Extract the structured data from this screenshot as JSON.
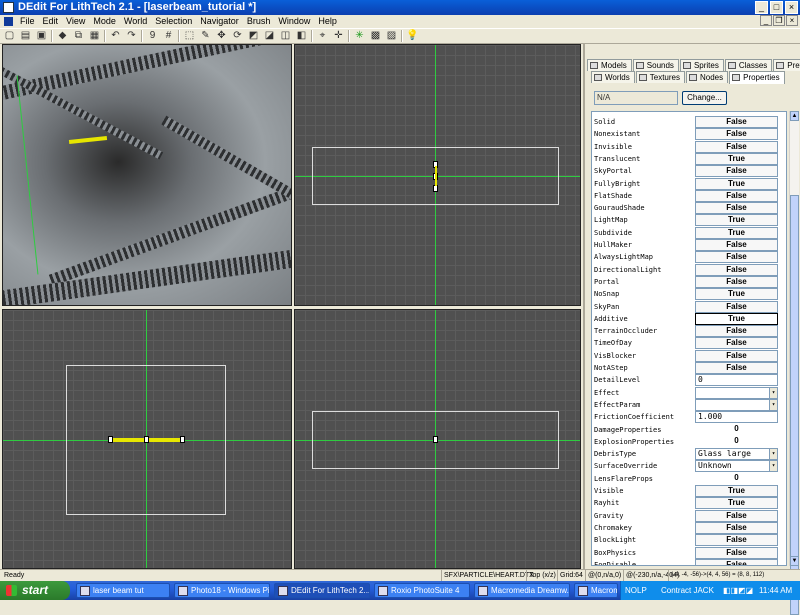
{
  "window": {
    "title": "DEdit For LithTech 2.1 - [laserbeam_tutorial *]",
    "min": "_",
    "max": "□",
    "close": "×"
  },
  "menu": [
    "File",
    "Edit",
    "View",
    "Mode",
    "World",
    "Selection",
    "Navigator",
    "Brush",
    "Window",
    "Help"
  ],
  "toolbar": {
    "icons": [
      "new-icon",
      "open-icon",
      "save-icon",
      "separator",
      "cut-icon",
      "copy-icon",
      "paste-icon",
      "separator",
      "undo-icon",
      "redo-icon",
      "separator",
      "grid-9-icon",
      "grid-icon",
      "separator",
      "select-icon",
      "brush-tool-icon",
      "move-icon",
      "rotate-icon",
      "geometry-icon",
      "paint-icon",
      "lightmap-icon",
      "object-icon",
      "separator",
      "crosshair-icon",
      "plus-icon",
      "separator",
      "green-star-icon",
      "render-icon",
      "fill-icon",
      "separator",
      "light-bulb-icon"
    ]
  },
  "panel": {
    "tabs_row1": [
      "Models",
      "Sounds",
      "Sprites",
      "Classes",
      "Prefabs"
    ],
    "tabs_row2": [
      "Worlds",
      "Textures",
      "Nodes",
      "Properties"
    ],
    "active_tab": "Properties",
    "field_value": "N/A",
    "change_button": "Change...",
    "properties": [
      {
        "name": "Solid",
        "value": "False"
      },
      {
        "name": "Nonexistant",
        "value": "False"
      },
      {
        "name": "Invisible",
        "value": "False"
      },
      {
        "name": "Translucent",
        "value": "True"
      },
      {
        "name": "SkyPortal",
        "value": "False"
      },
      {
        "name": "FullyBright",
        "value": "True"
      },
      {
        "name": "FlatShade",
        "value": "False"
      },
      {
        "name": "GouraudShade",
        "value": "False"
      },
      {
        "name": "LightMap",
        "value": "True"
      },
      {
        "name": "Subdivide",
        "value": "True"
      },
      {
        "name": "HullMaker",
        "value": "False"
      },
      {
        "name": "AlwaysLightMap",
        "value": "False"
      },
      {
        "name": "DirectionalLight",
        "value": "False"
      },
      {
        "name": "Portal",
        "value": "False"
      },
      {
        "name": "NoSnap",
        "value": "True"
      },
      {
        "name": "SkyPan",
        "value": "False"
      },
      {
        "name": "Additive",
        "value": "True"
      },
      {
        "name": "TerrainOccluder",
        "value": "False"
      },
      {
        "name": "TimeOfDay",
        "value": "False"
      },
      {
        "name": "VisBlocker",
        "value": "False"
      },
      {
        "name": "NotAStep",
        "value": "False"
      },
      {
        "name": "DetailLevel",
        "value": "0"
      },
      {
        "name": "Effect",
        "value": ""
      },
      {
        "name": "EffectParam",
        "value": ""
      },
      {
        "name": "FrictionCoefficient",
        "value": "1.000"
      },
      {
        "name": "DamageProperties",
        "value": "0"
      },
      {
        "name": "ExplosionProperties",
        "value": "0"
      },
      {
        "name": "DebrisType",
        "value": "Glass large"
      },
      {
        "name": "SurfaceOverride",
        "value": "Unknown"
      },
      {
        "name": "LensFlareProps",
        "value": "0"
      },
      {
        "name": "Visible",
        "value": "True"
      },
      {
        "name": "Rayhit",
        "value": "True"
      },
      {
        "name": "Gravity",
        "value": "False"
      },
      {
        "name": "Chromakey",
        "value": "False"
      },
      {
        "name": "BlockLight",
        "value": "False"
      },
      {
        "name": "BoxPhysics",
        "value": "False"
      },
      {
        "name": "FogDisable",
        "value": "False"
      }
    ]
  },
  "status": {
    "left": "Ready",
    "texture": "SFX\\PARTICLE\\HEART.DTX",
    "view": "Top (x/z)",
    "grid": "Grid:64",
    "pos": "@(0,n/a,0)",
    "coords": "@(-230,n/a,-404)",
    "extent": "(-4, -4, -56)->(4, 4, 56) = (8, 8, 112)"
  },
  "taskbar": {
    "start": "start",
    "tasks": [
      "laser beam tut",
      "Photo18 - Windows Pi...",
      "DEdit For LithTech 2....",
      "Roxio PhotoSuite 4",
      "Macromedia Dreamw...",
      "Macromedia Flash MX ..."
    ],
    "tray": {
      "nolp": "NOLP",
      "contract": "Contract JACK",
      "clock": "11:44 AM"
    }
  }
}
